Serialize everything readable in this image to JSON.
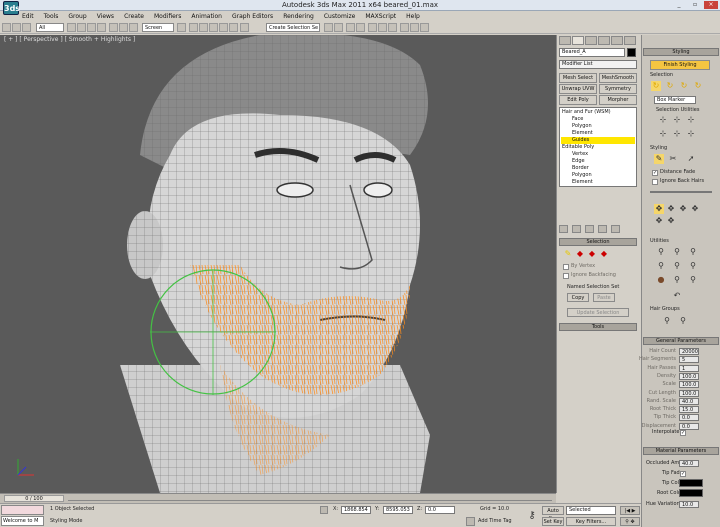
{
  "window": {
    "title": "Autodesk 3ds Max  2011 x64     beared_01.max",
    "logo": "3ds",
    "min": "_",
    "max": "▫",
    "close": "×"
  },
  "menubar": [
    "Edit",
    "Tools",
    "Group",
    "Views",
    "Create",
    "Modifiers",
    "Animation",
    "Graph Editors",
    "Rendering",
    "Customize",
    "MAXScript",
    "Help"
  ],
  "toolbar": {
    "filter": "All",
    "ref_coord": "Screen",
    "selection_set": "Create Selection Se"
  },
  "viewport": {
    "label": "[ + ] [ Perspective ] [ Smooth + Highlights ]"
  },
  "command_panel": {
    "object_name": "Beared_A",
    "modifier_list": "Modifier List",
    "buttons": [
      "Mesh Select",
      "MeshSmooth",
      "Unwrap UVW",
      "Symmetry",
      "Edit Poly",
      "Morpher"
    ],
    "stack": [
      {
        "label": "Hair and Fur (WSM)",
        "level": 0,
        "selected": false
      },
      {
        "label": "Face",
        "level": 1,
        "selected": false
      },
      {
        "label": "Polygon",
        "level": 1,
        "selected": false
      },
      {
        "label": "Element",
        "level": 1,
        "selected": false
      },
      {
        "label": "Guides",
        "level": 1,
        "selected": true
      },
      {
        "label": "Editable Poly",
        "level": 0,
        "selected": false
      },
      {
        "label": "Vertex",
        "level": 1,
        "selected": false
      },
      {
        "label": "Edge",
        "level": 1,
        "selected": false
      },
      {
        "label": "Border",
        "level": 1,
        "selected": false
      },
      {
        "label": "Polygon",
        "level": 1,
        "selected": false
      },
      {
        "label": "Element",
        "level": 1,
        "selected": false
      }
    ],
    "selection_rollout": "Selection",
    "by_vertex": "By Vertex",
    "ignore_backfacing": "Ignore Backfacing",
    "named_selection_set": "Named Selection Set",
    "copy": "Copy",
    "paste": "Paste",
    "update_selection": "Update Selection",
    "tools_rollout": "Tools"
  },
  "styling_panel": {
    "header": "Styling",
    "finish_styling": "Finish Styling",
    "selection_label": "Selection",
    "box_marker": "Box Marker",
    "selection_utilities": "Selection Utilities",
    "styling_label": "Styling",
    "distance_fade": "Distance Fade",
    "ignore_back_hairs": "Ignore Back Hairs",
    "utilities_label": "Utilities",
    "hair_groups": "Hair Groups",
    "general_parameters": "General Parameters",
    "params": [
      {
        "label": "Hair Count",
        "value": "20000"
      },
      {
        "label": "Hair Segments",
        "value": "5"
      },
      {
        "label": "Hair Passes",
        "value": "1"
      },
      {
        "label": "Density",
        "value": "100.0"
      },
      {
        "label": "Scale",
        "value": "100.0"
      },
      {
        "label": "Cut Length",
        "value": "100.0"
      },
      {
        "label": "Rand. Scale",
        "value": "40.0"
      },
      {
        "label": "Root Thick",
        "value": "15.0"
      },
      {
        "label": "Tip Thick",
        "value": "0.0"
      },
      {
        "label": "Displacement",
        "value": "0.0"
      }
    ],
    "interpolate": "Interpolate",
    "material_parameters": "Material Parameters",
    "mat_params": [
      {
        "label": "Occluded Amb.",
        "value": "40.0"
      },
      {
        "label": "Tip Fade",
        "value": ""
      },
      {
        "label": "Tip Color",
        "value": ""
      },
      {
        "label": "Root Color",
        "value": ""
      },
      {
        "label": "Hue Variation",
        "value": "10.0"
      }
    ],
    "colors": {
      "tip_color": "#000000",
      "root_color": "#000000"
    }
  },
  "timeline": {
    "frame": "0 / 100"
  },
  "status": {
    "maxscript": "Welcome to M",
    "selected": "1 Object Selected",
    "prompt": "Styling Mode",
    "x": "1868.854",
    "y": "8595.053",
    "z": "0.0",
    "grid": "Grid = 10.0",
    "auto_key": "Auto Key",
    "key_mode": "Selected",
    "set_key": "Set Key",
    "key_filters": "Key Filters...",
    "add_time_tag": "Add Time Tag"
  },
  "colors": {
    "hair": "#ff8c1a",
    "gizmo": "#44c244",
    "selected_row": "#ffe600"
  }
}
